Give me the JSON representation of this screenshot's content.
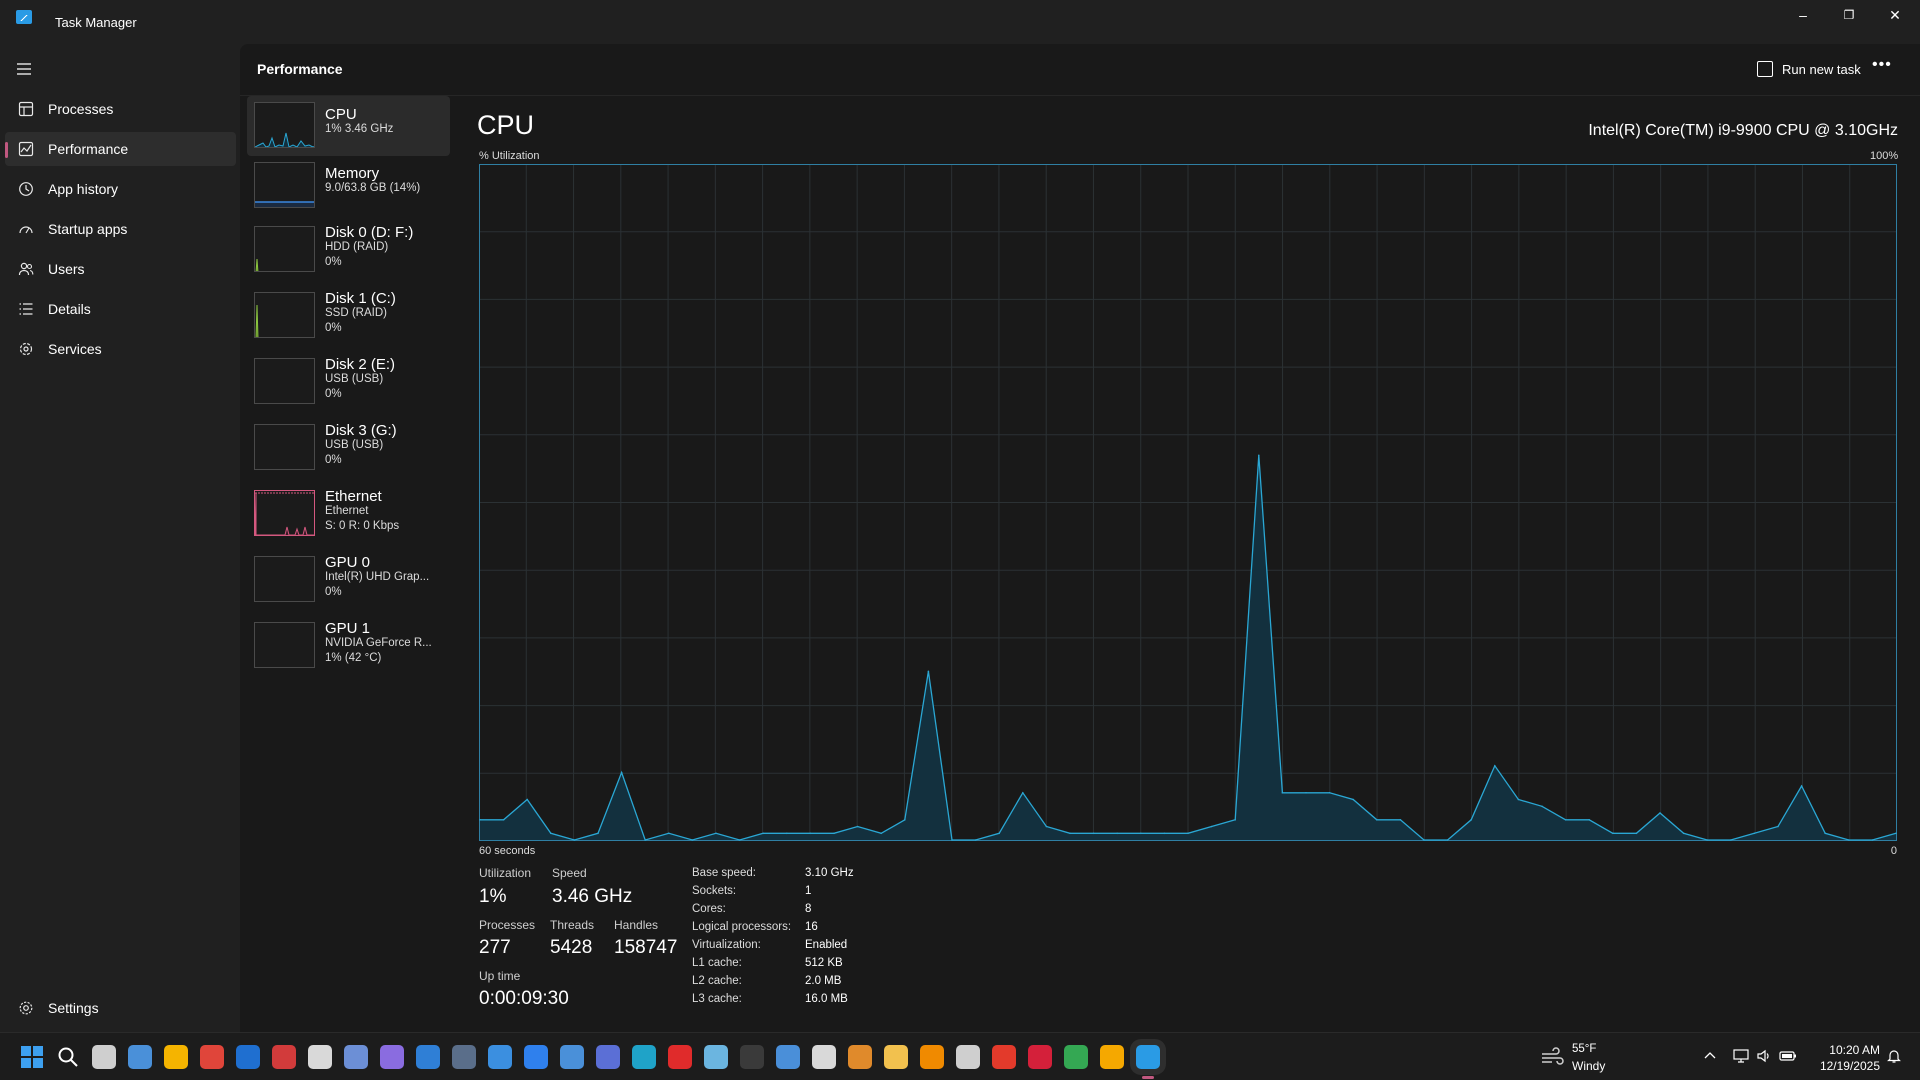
{
  "window": {
    "title": "Task Manager",
    "minimize": "–",
    "restore": "❐",
    "close": "✕"
  },
  "sidebar": {
    "menu_icon": "hamburger-icon",
    "items": [
      {
        "label": "Processes",
        "icon": "processes-icon"
      },
      {
        "label": "Performance",
        "icon": "performance-icon",
        "active": true
      },
      {
        "label": "App history",
        "icon": "app-history-icon"
      },
      {
        "label": "Startup apps",
        "icon": "startup-apps-icon"
      },
      {
        "label": "Users",
        "icon": "users-icon"
      },
      {
        "label": "Details",
        "icon": "details-icon"
      },
      {
        "label": "Services",
        "icon": "services-icon"
      }
    ],
    "settings": {
      "label": "Settings",
      "icon": "settings-icon"
    }
  },
  "header": {
    "title": "Performance",
    "run_new_task": "Run new task",
    "more": "•••"
  },
  "resources": [
    {
      "name": "CPU",
      "sub1": "1% 3.46 GHz",
      "sub2": "",
      "color": "#2aa7d4",
      "active": true
    },
    {
      "name": "Memory",
      "sub1": "9.0/63.8 GB (14%)",
      "sub2": "",
      "color": "#3b87e0"
    },
    {
      "name": "Disk 0 (D: F:)",
      "sub1": "HDD (RAID)",
      "sub2": "0%",
      "color": "#8cc63f"
    },
    {
      "name": "Disk 1 (C:)",
      "sub1": "SSD (RAID)",
      "sub2": "0%",
      "color": "#8cc63f"
    },
    {
      "name": "Disk 2 (E:)",
      "sub1": "USB (USB)",
      "sub2": "0%",
      "color": "#8cc63f"
    },
    {
      "name": "Disk 3 (G:)",
      "sub1": "USB (USB)",
      "sub2": "0%",
      "color": "#8cc63f"
    },
    {
      "name": "Ethernet",
      "sub1": "Ethernet",
      "sub2": "S: 0 R: 0 Kbps",
      "color": "#d4587f"
    },
    {
      "name": "GPU 0",
      "sub1": "Intel(R) UHD Grap...",
      "sub2": "0%",
      "color": "#2aa7d4"
    },
    {
      "name": "GPU 1",
      "sub1": "NVIDIA GeForce R...",
      "sub2": "1% (42 °C)",
      "color": "#2aa7d4"
    }
  ],
  "cpu": {
    "heading": "CPU",
    "model": "Intel(R) Core(TM) i9-9900 CPU @ 3.10GHz",
    "y_label": "% Utilization",
    "y_max_label": "100%",
    "x_left_label": "60 seconds",
    "x_right_label": "0",
    "line_color": "#2aa7d4",
    "fill_color": "#13303e",
    "grid_color": "#2b3134",
    "stats": {
      "utilization_label": "Utilization",
      "utilization": "1%",
      "speed_label": "Speed",
      "speed": "3.46 GHz",
      "processes_label": "Processes",
      "processes": "277",
      "threads_label": "Threads",
      "threads": "5428",
      "handles_label": "Handles",
      "handles": "158747",
      "uptime_label": "Up time",
      "uptime": "0:00:09:30"
    },
    "info": [
      {
        "label": "Base speed:",
        "value": "3.10 GHz"
      },
      {
        "label": "Sockets:",
        "value": "1"
      },
      {
        "label": "Cores:",
        "value": "8"
      },
      {
        "label": "Logical processors:",
        "value": "16"
      },
      {
        "label": "Virtualization:",
        "value": "Enabled"
      },
      {
        "label": "L1 cache:",
        "value": "512 KB"
      },
      {
        "label": "L2 cache:",
        "value": "2.0 MB"
      },
      {
        "label": "L3 cache:",
        "value": "16.0 MB"
      }
    ]
  },
  "chart_data": {
    "type": "area",
    "title": "CPU",
    "ylabel": "% Utilization",
    "xlabel": "60 seconds",
    "ylim": [
      0,
      100
    ],
    "xlim": [
      60,
      0
    ],
    "x": [
      60,
      59,
      58,
      57,
      56,
      55,
      54,
      53,
      52,
      51,
      50,
      49,
      48,
      47,
      46,
      45,
      44,
      43,
      42,
      41,
      40,
      39,
      38,
      37,
      36,
      35,
      34,
      33,
      32,
      31,
      30,
      29,
      28,
      27,
      26,
      25,
      24,
      23,
      22,
      21,
      20,
      19,
      18,
      17,
      16,
      15,
      14,
      13,
      12,
      11,
      10,
      9,
      8,
      7,
      6,
      5,
      4,
      3,
      2,
      1,
      0
    ],
    "series": [
      {
        "values": [
          3,
          3,
          6,
          1,
          0,
          1,
          10,
          0,
          1,
          0,
          1,
          0,
          1,
          1,
          1,
          1,
          2,
          1,
          3,
          25,
          0,
          0,
          1,
          7,
          2,
          1,
          1,
          1,
          1,
          1,
          1,
          2,
          3,
          57,
          7,
          7,
          7,
          6,
          3,
          3,
          0,
          0,
          3,
          11,
          6,
          5,
          3,
          3,
          1,
          1,
          4,
          1,
          0,
          0,
          1,
          2,
          8,
          1,
          0,
          0,
          1
        ]
      }
    ],
    "grid": true
  },
  "taskbar": {
    "apps": [
      {
        "name": "start-icon",
        "color": "#3da0f0"
      },
      {
        "name": "search-icon",
        "color": "#ffffff"
      },
      {
        "name": "task-view-icon",
        "color": "#cfcfcf"
      },
      {
        "name": "app-7-icon",
        "color": "#4a90d9"
      },
      {
        "name": "weather-app-icon",
        "color": "#f5b400"
      },
      {
        "name": "snipping-tool-icon",
        "color": "#e0453a"
      },
      {
        "name": "teamviewer-icon",
        "color": "#1f6fd0"
      },
      {
        "name": "photo-app-icon",
        "color": "#d23b3b"
      },
      {
        "name": "clock-app-icon",
        "color": "#d9d9d9"
      },
      {
        "name": "save-app-icon",
        "color": "#6c8fd6"
      },
      {
        "name": "q-app-icon",
        "color": "#8a6ce0"
      },
      {
        "name": "calendar-icon",
        "color": "#2f7fd6"
      },
      {
        "name": "calculator-icon",
        "color": "#5a6e8a"
      },
      {
        "name": "photos-icon",
        "color": "#3b8fe0"
      },
      {
        "name": "todo-icon",
        "color": "#2f80ed"
      },
      {
        "name": "camera-icon",
        "color": "#4a90d9"
      },
      {
        "name": "teams-icon",
        "color": "#5b6fd6"
      },
      {
        "name": "edge-icon",
        "color": "#1fa3c8"
      },
      {
        "name": "x-app-icon",
        "color": "#e02b2b"
      },
      {
        "name": "globe-app-icon",
        "color": "#6bb5e0"
      },
      {
        "name": "obs-icon",
        "color": "#3a3a3a"
      },
      {
        "name": "keyboard-app-icon",
        "color": "#4a8fd9"
      },
      {
        "name": "magnifier-icon",
        "color": "#d9d9d9"
      },
      {
        "name": "home-app-icon",
        "color": "#e08a2b"
      },
      {
        "name": "file-explorer-icon",
        "color": "#f2c14e"
      },
      {
        "name": "vlc-icon",
        "color": "#f08a00"
      },
      {
        "name": "film-app-icon",
        "color": "#cfcfcf"
      },
      {
        "name": "amazon-icon",
        "color": "#e33a2b"
      },
      {
        "name": "q-red-app-icon",
        "color": "#d4203a"
      },
      {
        "name": "chrome-icon",
        "color": "#34a853"
      },
      {
        "name": "aol-icon",
        "color": "#f5a800"
      },
      {
        "name": "task-manager-icon",
        "color": "#2a9be5"
      }
    ],
    "weather_temp": "55°F",
    "weather_desc": "Windy",
    "time": "10:20 AM",
    "date": "12/19/2025"
  }
}
